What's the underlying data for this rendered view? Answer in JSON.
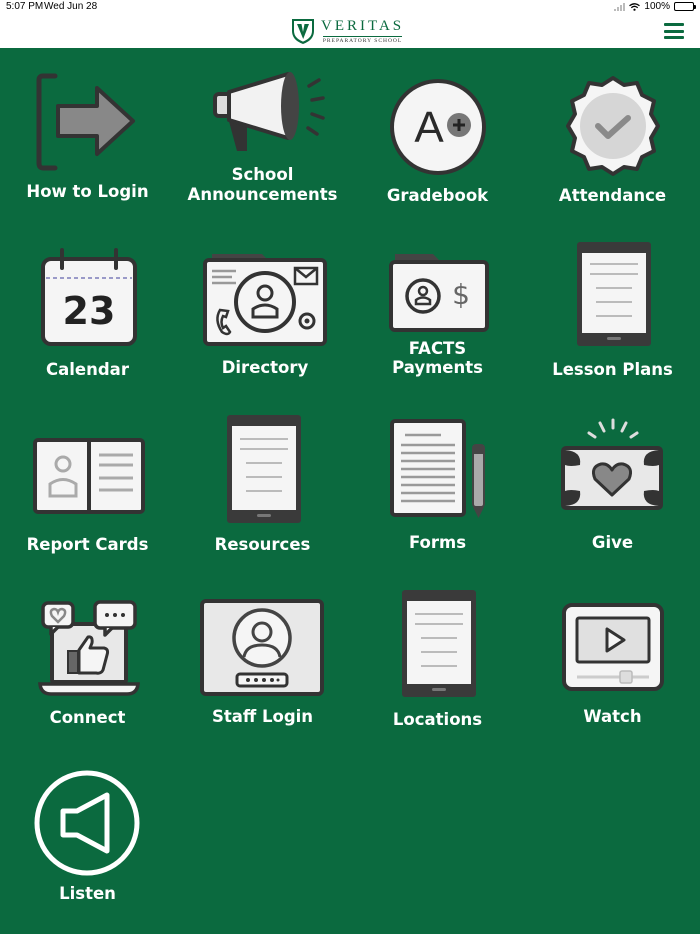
{
  "status_bar": {
    "time": "5:07 PM",
    "date": "Wed Jun 28",
    "battery": "100%"
  },
  "header": {
    "brand": "VERITAS",
    "subtitle": "PREPARATORY SCHOOL",
    "menu_icon": "hamburger-menu-icon"
  },
  "colors": {
    "brand_green": "#0b6a3f",
    "icon_fill": "#e8e8e8",
    "icon_stroke": "#3a3a3a",
    "header_bg": "#ffffff"
  },
  "tiles": {
    "how_to_login": "How to Login",
    "school_announcements": "School\nAnnouncements",
    "gradebook": "Gradebook",
    "gradebook_grade": "A",
    "attendance": "Attendance",
    "calendar": "Calendar",
    "calendar_day": "23",
    "directory": "Directory",
    "facts_payments": "FACTS\nPayments",
    "lesson_plans": "Lesson Plans",
    "report_cards": "Report Cards",
    "resources": "Resources",
    "forms": "Forms",
    "give": "Give",
    "connect": "Connect",
    "staff_login": "Staff Login",
    "locations": "Locations",
    "watch": "Watch",
    "listen": "Listen"
  }
}
